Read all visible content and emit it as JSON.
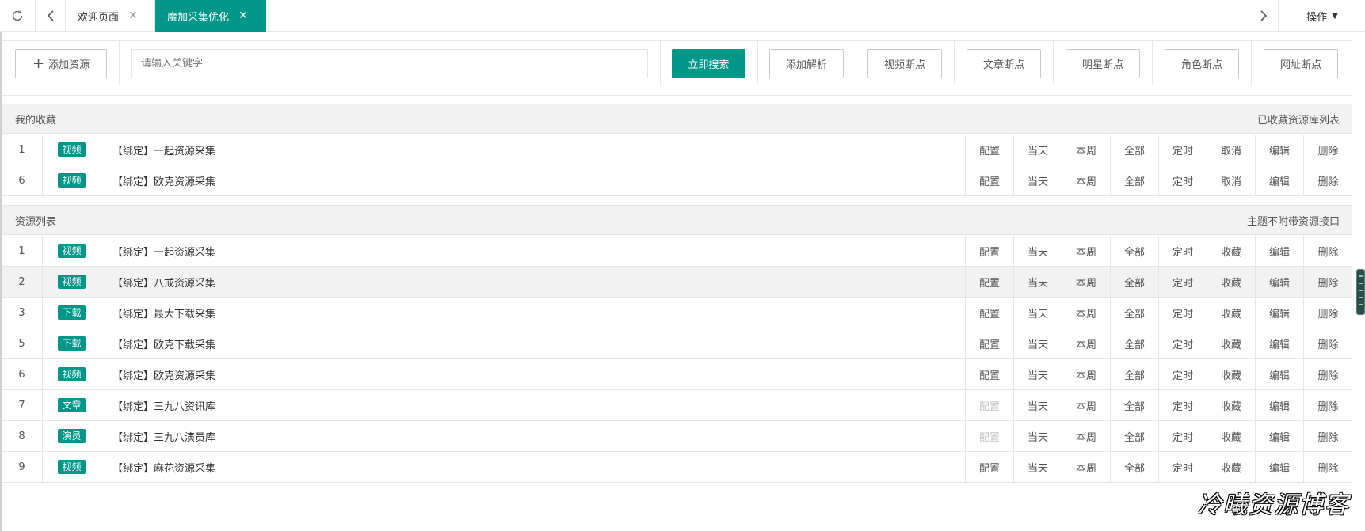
{
  "tabs": {
    "welcome": "欢迎页面",
    "active": "魔加采集优化",
    "close": "✕",
    "ops_label": "操作"
  },
  "toolbar": {
    "add_label": "添加资源",
    "search_placeholder": "请输入关键字",
    "search_button": "立即搜索",
    "buttons": [
      "添加解析",
      "视频断点",
      "文章断点",
      "明星断点",
      "角色断点",
      "网址断点"
    ]
  },
  "favorites": {
    "title": "我的收藏",
    "right_label": "已收藏资源库列表",
    "rows": [
      {
        "id": "1",
        "tag": "视频",
        "name": "【绑定】一起资源采集",
        "actions": [
          "配置",
          "当天",
          "本周",
          "全部",
          "定时",
          "取消",
          "编辑",
          "删除"
        ]
      },
      {
        "id": "6",
        "tag": "视频",
        "name": "【绑定】欧克资源采集",
        "actions": [
          "配置",
          "当天",
          "本周",
          "全部",
          "定时",
          "取消",
          "编辑",
          "删除"
        ]
      }
    ]
  },
  "resources": {
    "title": "资源列表",
    "right_label": "主题不附带资源接口",
    "rows": [
      {
        "id": "1",
        "tag": "视频",
        "name": "【绑定】一起资源采集",
        "actions": [
          "配置",
          "当天",
          "本周",
          "全部",
          "定时",
          "收藏",
          "编辑",
          "删除"
        ]
      },
      {
        "id": "2",
        "tag": "视频",
        "name": "【绑定】八戒资源采集",
        "actions": [
          "配置",
          "当天",
          "本周",
          "全部",
          "定时",
          "收藏",
          "编辑",
          "删除"
        ]
      },
      {
        "id": "3",
        "tag": "下载",
        "name": "【绑定】最大下载采集",
        "actions": [
          "配置",
          "当天",
          "本周",
          "全部",
          "定时",
          "收藏",
          "编辑",
          "删除"
        ]
      },
      {
        "id": "5",
        "tag": "下载",
        "name": "【绑定】欧克下载采集",
        "actions": [
          "配置",
          "当天",
          "本周",
          "全部",
          "定时",
          "收藏",
          "编辑",
          "删除"
        ]
      },
      {
        "id": "6",
        "tag": "视频",
        "name": "【绑定】欧克资源采集",
        "actions": [
          "配置",
          "当天",
          "本周",
          "全部",
          "定时",
          "收藏",
          "编辑",
          "删除"
        ]
      },
      {
        "id": "7",
        "tag": "文章",
        "name": "【绑定】三九八资讯库",
        "actions": [
          "配置",
          "当天",
          "本周",
          "全部",
          "定时",
          "收藏",
          "编辑",
          "删除"
        ],
        "config_disabled": true
      },
      {
        "id": "8",
        "tag": "演员",
        "name": "【绑定】三九八演员库",
        "actions": [
          "配置",
          "当天",
          "本周",
          "全部",
          "定时",
          "收藏",
          "编辑",
          "删除"
        ],
        "config_disabled": true
      },
      {
        "id": "9",
        "tag": "视频",
        "name": "【绑定】麻花资源采集",
        "actions": [
          "配置",
          "当天",
          "本周",
          "全部",
          "定时",
          "收藏",
          "编辑",
          "删除"
        ]
      }
    ]
  },
  "watermark": "冷曦资源博客",
  "colors": {
    "accent": "#009688",
    "disabled_text": "#c2c2c2"
  }
}
